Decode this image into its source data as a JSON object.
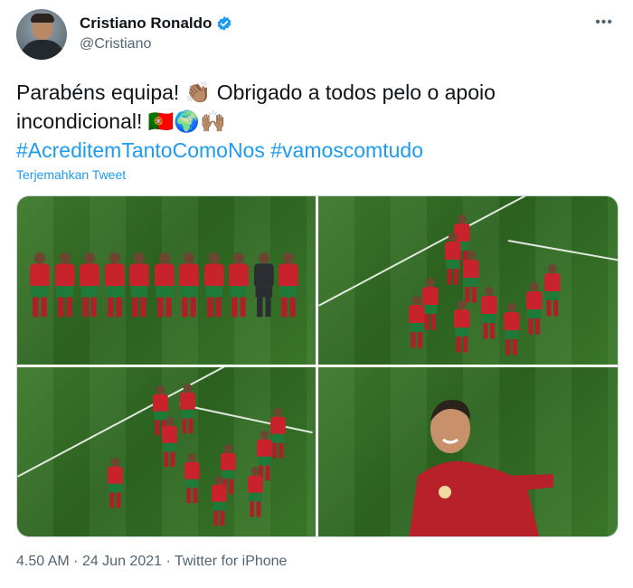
{
  "tweet": {
    "author": {
      "display_name": "Cristiano Ronaldo",
      "handle": "@Cristiano",
      "verified": true
    },
    "more_icon": "ellipsis-icon",
    "text": "Parabéns equipa! 👏🏽 Obrigado a todos pelo o apoio incondicional! 🇵🇹🌍🙌🏽",
    "hashtags": [
      "#AcreditemTantoComoNos",
      "#vamoscomtudo"
    ],
    "translate_label": "Terjemahkan Tweet",
    "media": {
      "count": 4
    },
    "meta": {
      "time": "4.50 AM",
      "separator": "·",
      "date": "24 Jun 2021",
      "source": "Twitter for iPhone"
    }
  },
  "colors": {
    "link": "#1d9bf0",
    "secondary_text": "#536471",
    "pitch_green": "#2d6420",
    "kit_red": "#c8232c",
    "kit_green": "#1f7a3a"
  }
}
